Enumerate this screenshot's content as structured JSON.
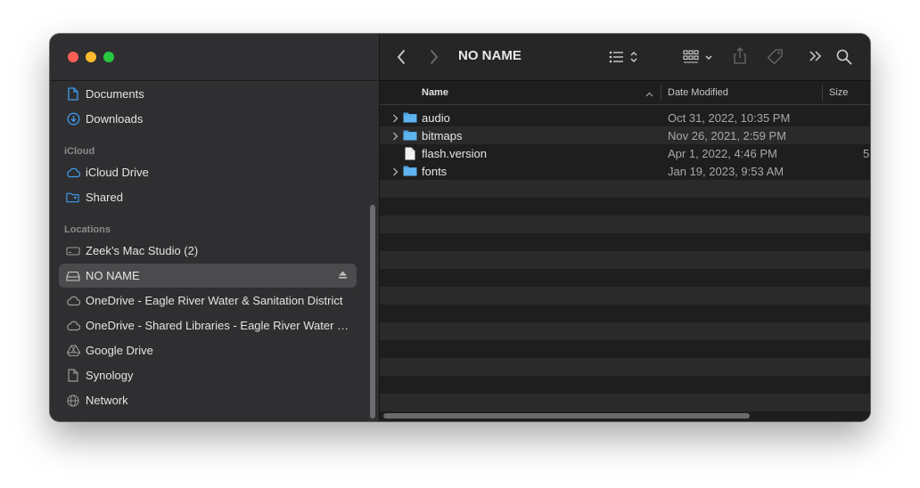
{
  "window": {
    "title": "NO NAME"
  },
  "sidebar": {
    "top_items": [
      {
        "label": "Documents",
        "icon": "document-icon"
      },
      {
        "label": "Downloads",
        "icon": "download-icon"
      }
    ],
    "icloud_heading": "iCloud",
    "icloud_items": [
      {
        "label": "iCloud Drive",
        "icon": "cloud-icon"
      },
      {
        "label": "Shared",
        "icon": "shared-folder-icon"
      }
    ],
    "locations_heading": "Locations",
    "location_items": [
      {
        "label": "Zeek’s Mac Studio (2)",
        "icon": "computer-icon"
      },
      {
        "label": "NO NAME",
        "icon": "drive-icon",
        "selected": true
      },
      {
        "label": "OneDrive - Eagle River Water & Sanitation District",
        "icon": "cloud-icon"
      },
      {
        "label": "OneDrive - Shared Libraries - Eagle River Water & Sanitation District",
        "icon": "cloud-icon"
      },
      {
        "label": "Google Drive",
        "icon": "google-drive-icon"
      },
      {
        "label": "Synology",
        "icon": "document-icon"
      },
      {
        "label": "Network",
        "icon": "globe-icon"
      }
    ]
  },
  "columns": {
    "name": "Name",
    "date_modified": "Date Modified",
    "size": "Size"
  },
  "files": [
    {
      "name": "audio",
      "date": "Oct 31, 2022, 10:35 PM",
      "size": "",
      "type": "folder"
    },
    {
      "name": "bitmaps",
      "date": "Nov 26, 2021, 2:59 PM",
      "size": "",
      "type": "folder"
    },
    {
      "name": "flash.version",
      "date": "Apr 1, 2022, 4:46 PM",
      "size": "5",
      "type": "file"
    },
    {
      "name": "fonts",
      "date": "Jan 19, 2023, 9:53 AM",
      "size": "",
      "type": "folder"
    }
  ],
  "colors": {
    "accent_folder": "#4fa3e0",
    "sidebar_icon": "#3d9bf0"
  }
}
